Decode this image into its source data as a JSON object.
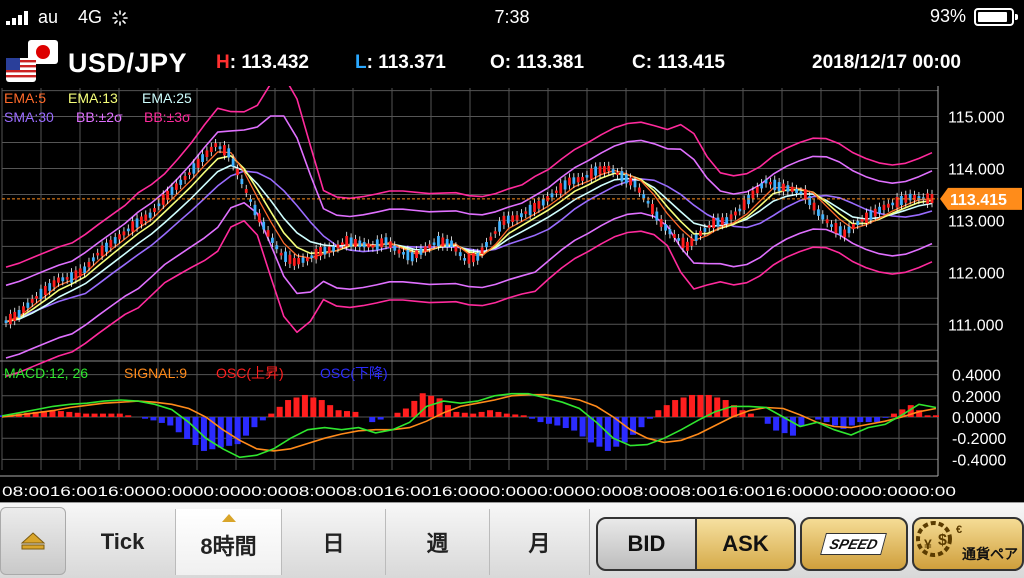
{
  "status": {
    "carrier": "au",
    "network": "4G",
    "time": "7:38",
    "battery": "93%",
    "battery_level": 0.93
  },
  "header": {
    "pair": "USD/JPY",
    "high_label": "H",
    "high": "113.432",
    "low_label": "L",
    "low": "113.371",
    "open_label": "O",
    "open": "113.381",
    "close_label": "C",
    "close": "113.415",
    "datetime": "2018/12/17 00:00"
  },
  "indicators": {
    "ema5": "EMA:5",
    "ema13": "EMA:13",
    "ema25": "EMA:25",
    "sma30": "SMA:30",
    "bb2": "BB:±2σ",
    "bb3": "BB:±3σ",
    "macd": "MACD:12, 26",
    "signal": "SIGNAL:9",
    "osc_up": "OSC(上昇)",
    "osc_down": "OSC(下降)"
  },
  "colors": {
    "ema5": "#ff6a2a",
    "ema13": "#f6ff7a",
    "ema25": "#cfffff",
    "sma30": "#9a6cff",
    "bb2": "#e070ff",
    "bb3": "#ff2a9c",
    "macd": "#2fe62f",
    "signal": "#ff8a1a",
    "osc_up": "#ff1e1e",
    "osc_down": "#2b2bff",
    "current_price_bg": "#ff8c1a",
    "high_key": "#ff3030",
    "low_key": "#2aa8ff"
  },
  "chart_data": {
    "type": "line",
    "price_axis": {
      "ticks": [
        "115.000",
        "114.000",
        "113.000",
        "112.000",
        "111.000"
      ],
      "tick_values": [
        115,
        114,
        113,
        112,
        111
      ],
      "ylim": [
        110.35,
        115.55
      ]
    },
    "current_price": "113.415",
    "current_price_value": 113.415,
    "macd_axis": {
      "ticks": [
        "0.4000",
        "0.2000",
        "0.0000",
        "-0.2000",
        "-0.4000"
      ],
      "tick_values": [
        0.4,
        0.2,
        0,
        -0.2,
        -0.4
      ],
      "ylim": [
        -0.5,
        0.5
      ]
    },
    "time_axis_text": "08:0016:0016:0000:0000:0000:0008:0008:0016:0016:0000:0000:0000:0008:0008:0016:0016:0000:0000:0000:00",
    "series_close": [
      111.05,
      111.2,
      111.45,
      111.65,
      111.85,
      111.9,
      112.05,
      112.35,
      112.55,
      112.75,
      112.95,
      113.1,
      113.4,
      113.65,
      113.9,
      114.2,
      114.45,
      114.3,
      113.75,
      113.2,
      112.75,
      112.35,
      112.2,
      112.25,
      112.4,
      112.45,
      112.6,
      112.55,
      112.5,
      112.6,
      112.4,
      112.3,
      112.45,
      112.6,
      112.55,
      112.25,
      112.3,
      112.65,
      113.0,
      113.05,
      113.2,
      113.35,
      113.55,
      113.75,
      113.8,
      113.95,
      114.0,
      113.85,
      113.7,
      113.35,
      112.95,
      112.7,
      112.5,
      112.75,
      112.95,
      113.0,
      113.2,
      113.5,
      113.75,
      113.65,
      113.6,
      113.5,
      113.15,
      112.9,
      112.75,
      112.95,
      113.1,
      113.25,
      113.35,
      113.45,
      113.42
    ],
    "series_macd": [
      0.01,
      0.04,
      0.07,
      0.1,
      0.12,
      0.13,
      0.15,
      0.16,
      0.15,
      0.12,
      0.07,
      -0.05,
      -0.2,
      -0.3,
      -0.38,
      -0.36,
      -0.3,
      -0.2,
      -0.12,
      -0.1,
      -0.12,
      -0.1,
      -0.15,
      -0.12,
      -0.05,
      0.1,
      0.15,
      0.13,
      0.15,
      0.2,
      0.22,
      0.22,
      0.18,
      0.14,
      0.08,
      -0.05,
      -0.2,
      -0.27,
      -0.26,
      -0.2,
      -0.12,
      -0.03,
      0.05,
      0.1,
      0.1,
      0.09,
      0.0,
      -0.09,
      -0.05,
      -0.12,
      -0.17,
      -0.1,
      -0.07,
      0.02,
      0.12,
      0.09
    ],
    "series_signal": [
      0.0,
      0.02,
      0.04,
      0.06,
      0.09,
      0.11,
      0.13,
      0.14,
      0.15,
      0.14,
      0.12,
      0.08,
      0.0,
      -0.12,
      -0.22,
      -0.3,
      -0.32,
      -0.3,
      -0.25,
      -0.2,
      -0.16,
      -0.13,
      -0.12,
      -0.12,
      -0.1,
      -0.04,
      0.04,
      0.1,
      0.13,
      0.16,
      0.2,
      0.21,
      0.21,
      0.19,
      0.16,
      0.1,
      0.0,
      -0.12,
      -0.2,
      -0.24,
      -0.22,
      -0.16,
      -0.08,
      0.0,
      0.06,
      0.09,
      0.08,
      0.02,
      -0.05,
      -0.09,
      -0.1,
      -0.07,
      -0.04,
      0.0,
      0.05,
      0.08
    ]
  },
  "toolbar": {
    "tick": "Tick",
    "h8": "8時間",
    "day": "日",
    "week": "週",
    "month": "月",
    "bid": "BID",
    "ask": "ASK",
    "speed": "SPEED",
    "pair_select": "通貨ペア"
  }
}
